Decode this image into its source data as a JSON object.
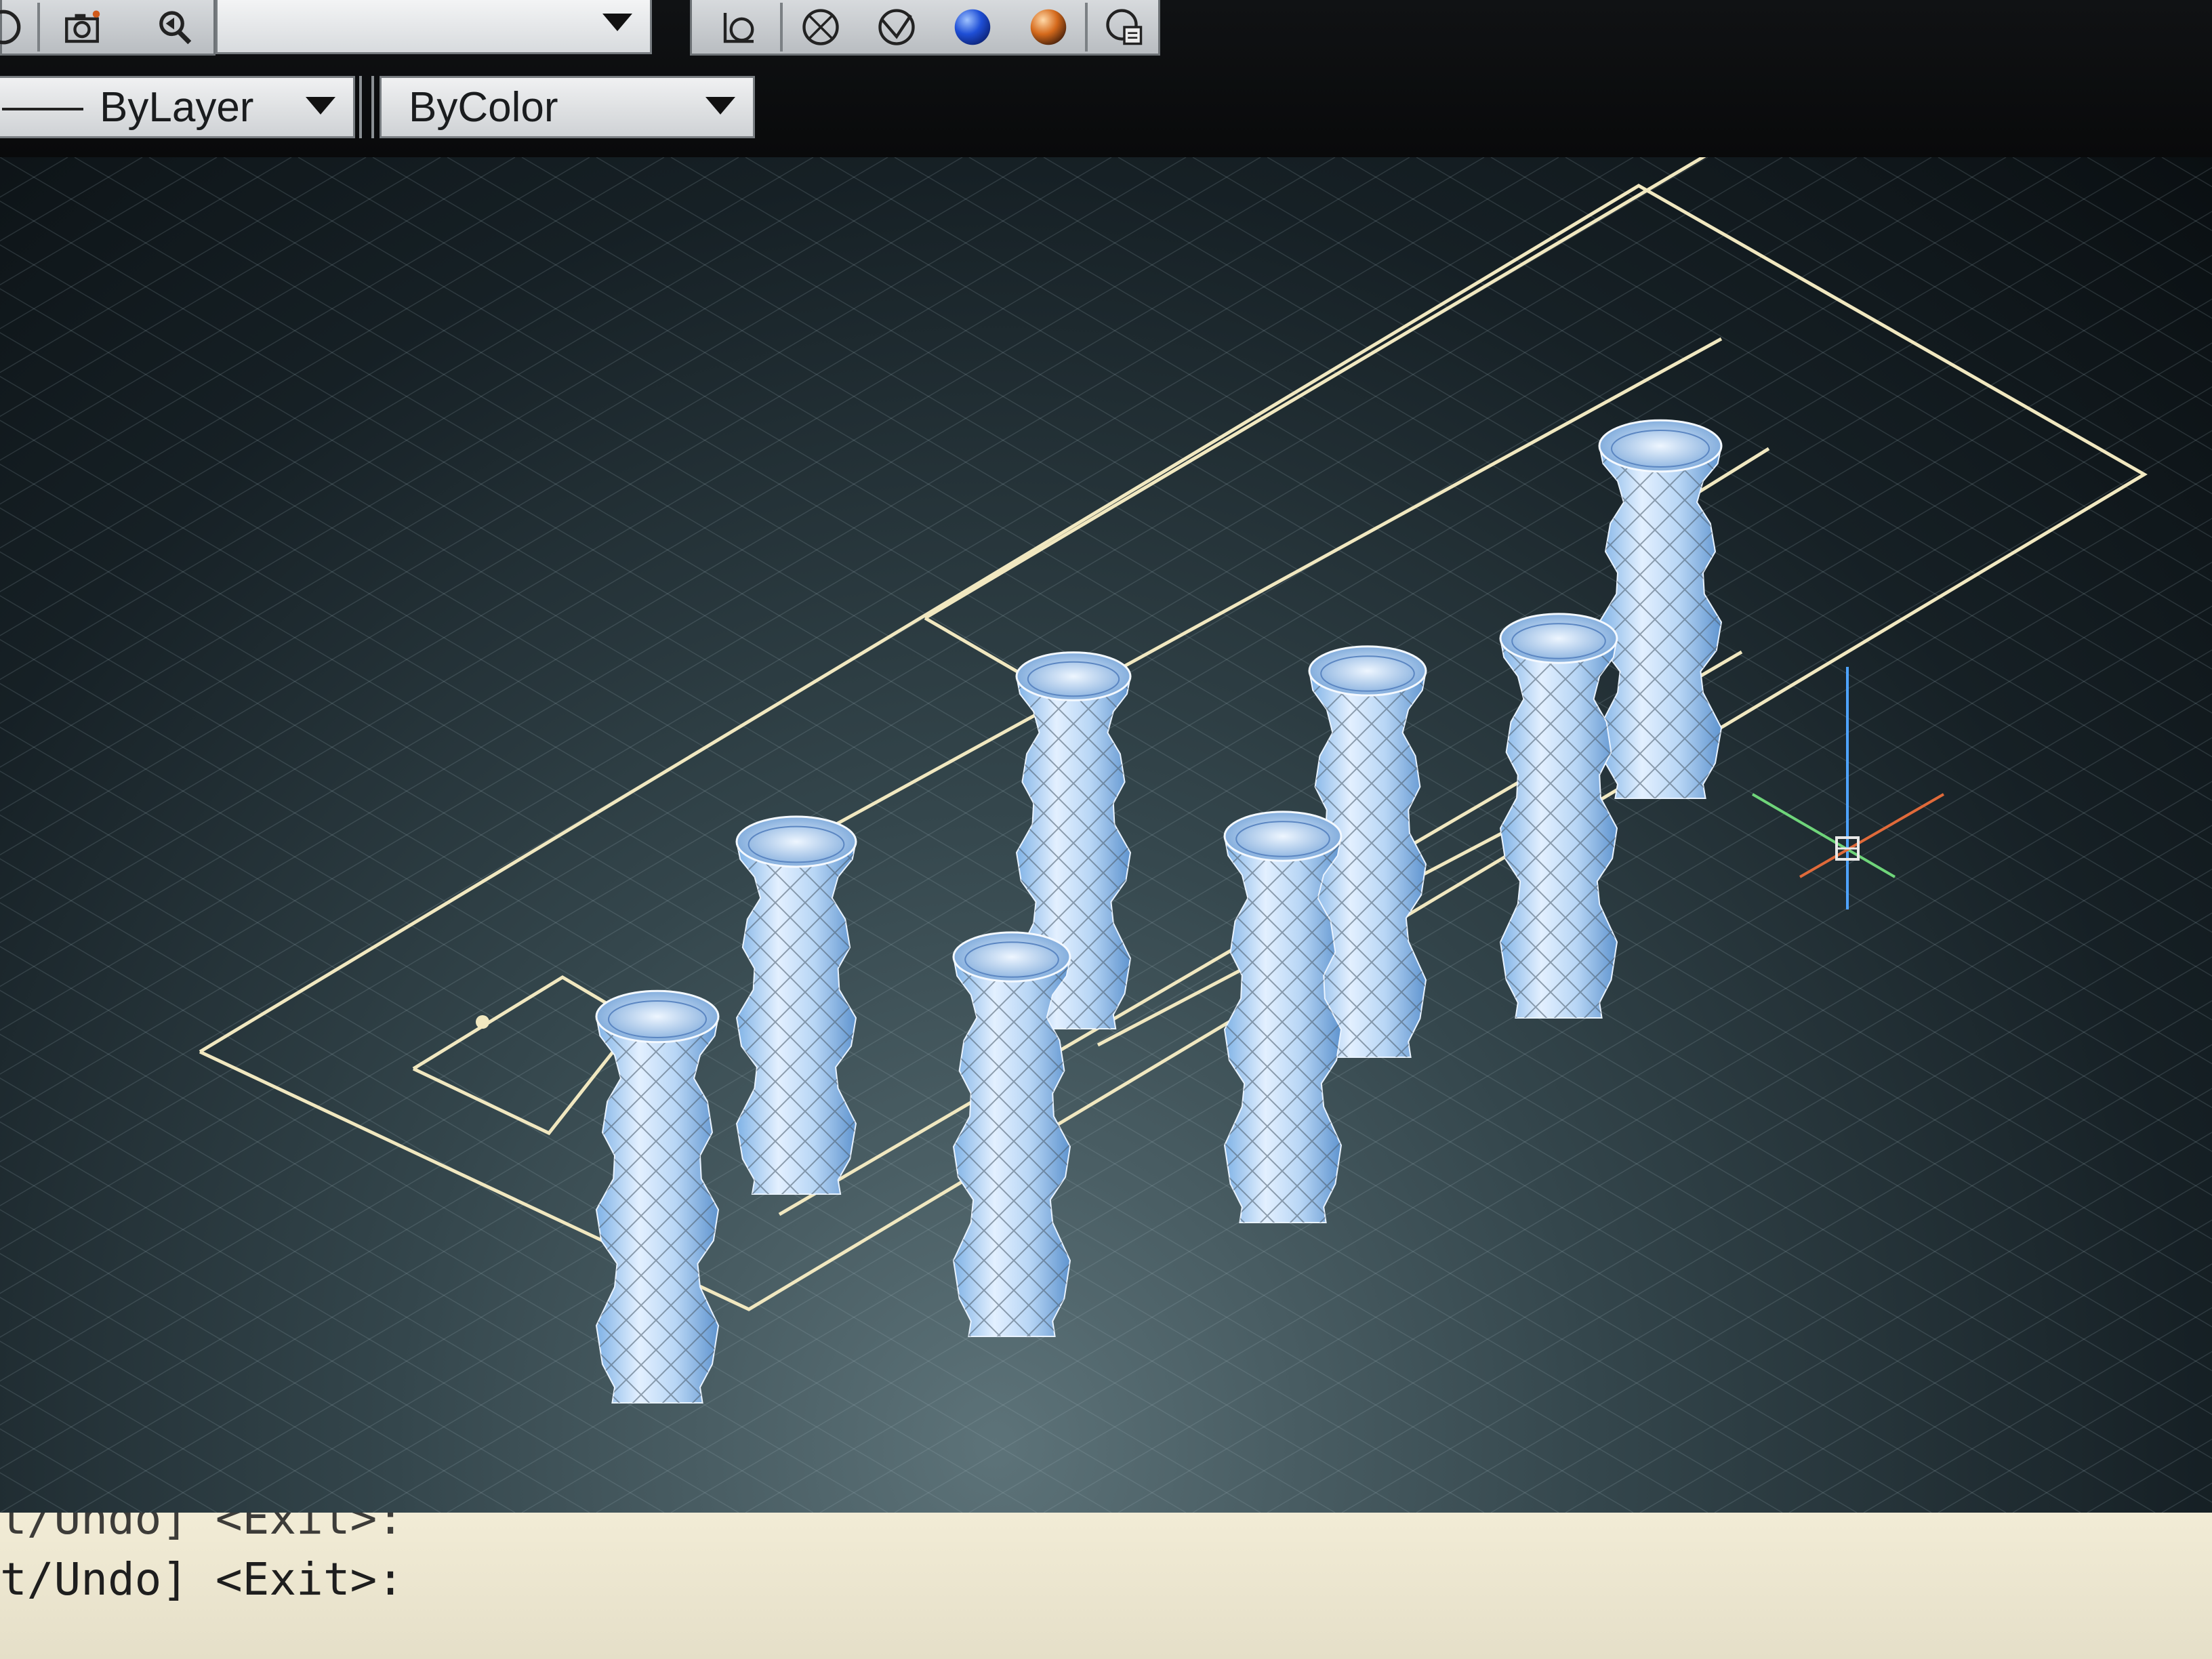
{
  "toolbar": {
    "icons": [
      {
        "name": "camera-icon"
      },
      {
        "name": "zoom-pan-icon"
      },
      {
        "name": "ucs-icon"
      },
      {
        "name": "wireframe-sphere-icon"
      },
      {
        "name": "hidden-sphere-icon"
      },
      {
        "name": "shaded-sphere-blue-icon",
        "color": "#1f4fd6"
      },
      {
        "name": "shaded-sphere-orange-icon",
        "color": "#d56a1c"
      },
      {
        "name": "sphere-settings-icon"
      }
    ],
    "linetype_value": "ByLayer",
    "plotstyle_value": "ByColor"
  },
  "viewport": {
    "background_color": "#2c3c42",
    "wire_color": "#f1e8c0",
    "solid_color": "#9cc6ef",
    "ucs_colors": {
      "x": "#e06a3a",
      "y": "#6fd57a",
      "z": "#4ea3ff"
    }
  },
  "command_line": {
    "line1": "t/Undo] <Exit>:",
    "line2": "t/Undo] <Exit>:"
  }
}
